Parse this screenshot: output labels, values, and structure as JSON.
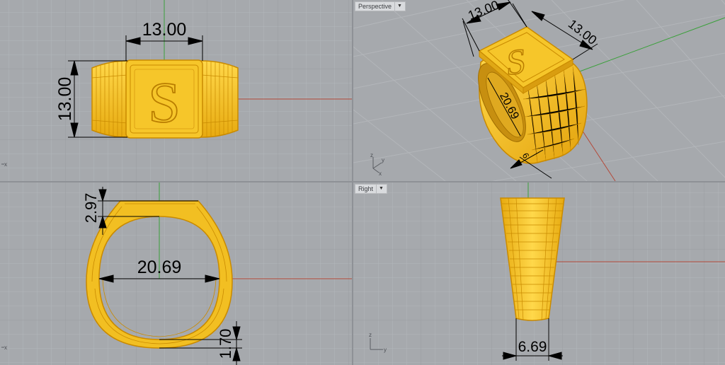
{
  "colors": {
    "background": "#a6a9ad",
    "grid_minor": "#b3b6ba",
    "grid_major": "#9a9da1",
    "x_axis": "#b44a3a",
    "y_axis": "#3aa03a",
    "ring_fill": "#f2bf22",
    "ring_edge": "#c98a00",
    "ring_highlight": "#ffd84a",
    "dimension": "#000000"
  },
  "viewports": {
    "top": {
      "dimensions": {
        "width": "13.00",
        "height": "13.00"
      },
      "axis_label": "x",
      "emblem_letter": "S"
    },
    "perspective": {
      "label": "Perspective",
      "dimensions": {
        "edge_a": "13.00",
        "edge_b": "13.00",
        "inner": "20.69",
        "band": "6"
      },
      "emblem_letter": "S",
      "axis_labels": {
        "z": "z",
        "y": "y",
        "x": "x"
      }
    },
    "front": {
      "dimensions": {
        "top_thickness": "2.97",
        "inner_diameter": "20.69",
        "bottom_thickness": "1.70"
      },
      "axis_label": "x"
    },
    "right": {
      "label": "Right",
      "dimensions": {
        "bottom_width": "6.69"
      },
      "axis_labels": {
        "z": "z",
        "y": "y"
      }
    }
  }
}
